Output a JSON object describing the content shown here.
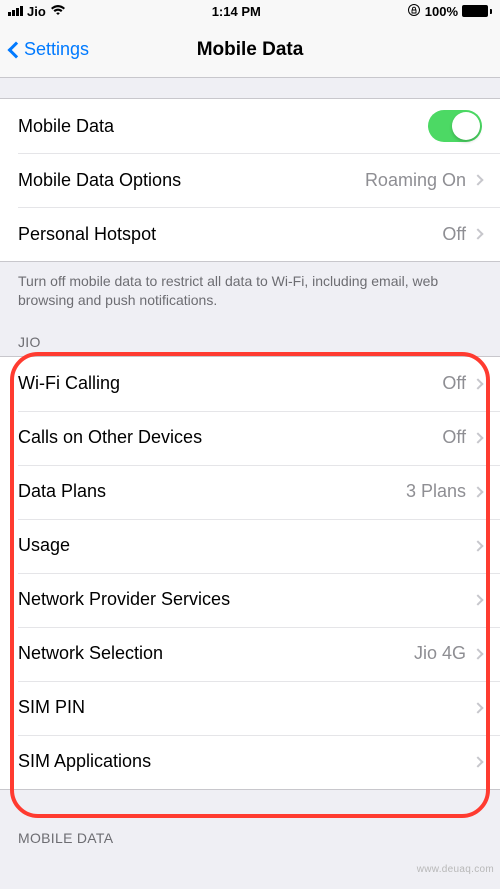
{
  "status": {
    "carrier": "Jio",
    "time": "1:14 PM",
    "battery_pct": "100%"
  },
  "nav": {
    "back_label": "Settings",
    "title": "Mobile Data"
  },
  "group1": {
    "mobile_data_label": "Mobile Data",
    "mobile_data_options_label": "Mobile Data Options",
    "mobile_data_options_value": "Roaming On",
    "personal_hotspot_label": "Personal Hotspot",
    "personal_hotspot_value": "Off",
    "footer": "Turn off mobile data to restrict all data to Wi-Fi, including email, web browsing and push notifications."
  },
  "section_jio": {
    "header": "JIO",
    "wifi_calling_label": "Wi-Fi Calling",
    "wifi_calling_value": "Off",
    "calls_other_label": "Calls on Other Devices",
    "calls_other_value": "Off",
    "data_plans_label": "Data Plans",
    "data_plans_value": "3 Plans",
    "usage_label": "Usage",
    "provider_services_label": "Network Provider Services",
    "network_selection_label": "Network Selection",
    "network_selection_value": "Jio 4G",
    "sim_pin_label": "SIM PIN",
    "sim_apps_label": "SIM Applications"
  },
  "section_mobile_data_header": "MOBILE DATA",
  "watermark": "www.deuaq.com"
}
